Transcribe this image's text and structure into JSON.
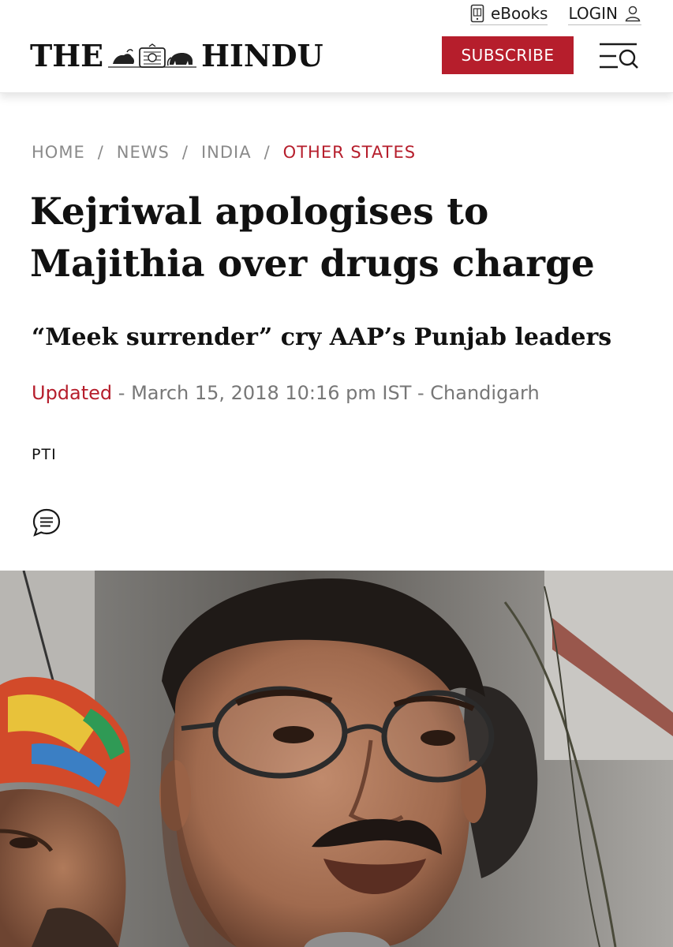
{
  "header": {
    "ebooks_label": "eBooks",
    "login_label": "LOGIN",
    "logo_left": "THE",
    "logo_right": "HINDU",
    "subscribe_label": "SUBSCRIBE",
    "icons": {
      "ebooks": "book-icon",
      "login": "user-icon",
      "menu": "menu-search-icon"
    },
    "brand_color": "#b61e2c"
  },
  "breadcrumb": {
    "items": [
      "HOME",
      "NEWS",
      "INDIA",
      "OTHER STATES"
    ],
    "separator": "/"
  },
  "article": {
    "headline": "Kejriwal apologises to Majithia over drugs charge",
    "subheadline": "“Meek surrender” cry AAP’s Punjab leaders",
    "updated_label": "Updated",
    "dateline": " - March 15, 2018 10:16 pm IST - Chandigarh",
    "byline": "PTI",
    "comment_icon": "comment-icon"
  }
}
